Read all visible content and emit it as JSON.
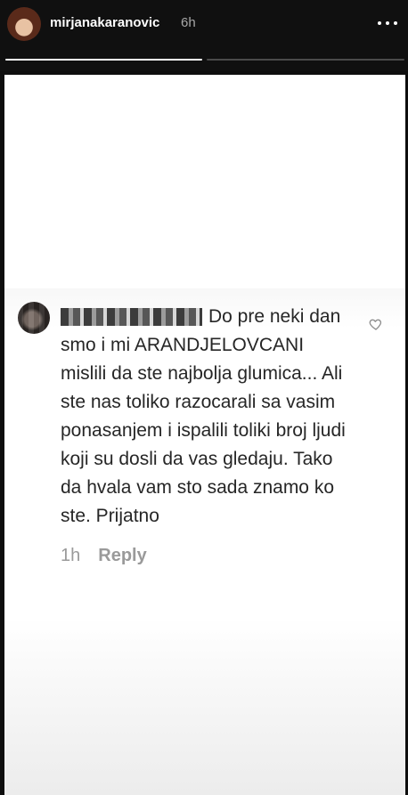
{
  "story": {
    "username": "mirjanakaranovic",
    "time_ago": "6h",
    "progress": [
      1.0,
      0.0
    ]
  },
  "comment": {
    "text": "Do pre neki dan smo i mi ARANDJELOVCANI mislili da ste najbolja glumica... Ali ste nas toliko razocarali sa vasim ponasanjem i ispalili toliki broj ljudi koji su dosli da vas gledaju. Tako da hvala vam sto sada znamo ko ste. Prijatno",
    "time_ago": "1h",
    "reply_label": "Reply"
  },
  "icons": {
    "more": "more-options-icon",
    "like": "heart-icon"
  },
  "colors": {
    "header_bg": "#101010",
    "comment_text": "#262626",
    "meta_text": "#9a9a9a"
  }
}
